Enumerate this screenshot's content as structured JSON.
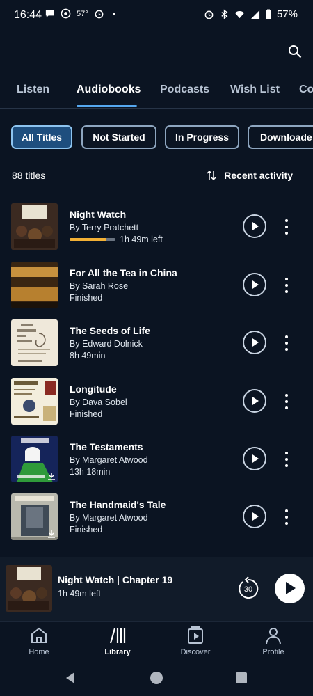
{
  "status_bar": {
    "time": "16:44",
    "temperature": "57°",
    "battery": "57%",
    "icons": [
      "chat-bubble-icon",
      "whatsapp-icon",
      "alarm-icon",
      "dot-icon",
      "alarm-icon",
      "bluetooth-icon",
      "wifi-icon",
      "signal-icon",
      "battery-icon"
    ]
  },
  "header": {
    "search_icon": "search-icon"
  },
  "tabs": [
    {
      "label": "Listen",
      "active": false
    },
    {
      "label": "Audiobooks",
      "active": true
    },
    {
      "label": "Podcasts",
      "active": false
    },
    {
      "label": "Wish List",
      "active": false
    },
    {
      "label": "Co",
      "active": false
    }
  ],
  "filters": [
    {
      "label": "All Titles",
      "active": true
    },
    {
      "label": "Not Started",
      "active": false
    },
    {
      "label": "In Progress",
      "active": false
    },
    {
      "label": "Downloade",
      "active": false
    }
  ],
  "library": {
    "count": "88 titles",
    "sort_label": "Recent activity"
  },
  "books": [
    {
      "title": "Night Watch",
      "author": "By Terry Pratchett",
      "status": "1h 49m left",
      "progress": 0.8,
      "cover_text": [
        "Terry Pratchett",
        "Night Watch"
      ],
      "cover_bg": "#3a2a22"
    },
    {
      "title": "For All the Tea in China",
      "author": "By Sarah Rose",
      "status": "Finished",
      "cover_text": [
        "For All The Tea in China",
        "Sarah Rose"
      ],
      "cover_bg": "#2b1d10"
    },
    {
      "title": "The Seeds of Life",
      "author": "By Edward Dolnick",
      "status": "8h 49min",
      "cover_text": [
        "THE",
        "SEEDS",
        "OF",
        "LIFE"
      ],
      "cover_bg": "#efe8da"
    },
    {
      "title": "Longitude",
      "author": "By Dava Sobel",
      "status": "Finished",
      "cover_text": [
        "Longitude",
        "DAVA SOBEL"
      ],
      "cover_bg": "#f3eedd"
    },
    {
      "title": "The Testaments",
      "author": "By Margaret Atwood",
      "status": "13h 18min",
      "cover_text": [
        "ATWOOD",
        "TESTAME"
      ],
      "cover_bg": "#15245a",
      "downloaded": true
    },
    {
      "title": "The Handmaid's Tale",
      "author": "By Margaret Atwood",
      "status": "Finished",
      "cover_text": [
        "MARGARET ATWOOD"
      ],
      "cover_bg": "#b9b9ae",
      "downloaded": true
    }
  ],
  "mini_player": {
    "title": "Night Watch | Chapter 19",
    "time_left": "1h 49m left",
    "skip_seconds": "30",
    "cover_text": [
      "Terry Pratchett",
      "Night Watch"
    ]
  },
  "bottom_nav": [
    {
      "label": "Home",
      "icon": "home-icon",
      "active": false
    },
    {
      "label": "Library",
      "icon": "library-icon",
      "active": true
    },
    {
      "label": "Discover",
      "icon": "discover-icon",
      "active": false
    },
    {
      "label": "Profile",
      "icon": "profile-icon",
      "active": false
    }
  ],
  "colors": {
    "background": "#0b1422",
    "accent": "#56a8f0",
    "active_chip": "#1e4e7e",
    "progress": "#f2b035"
  }
}
